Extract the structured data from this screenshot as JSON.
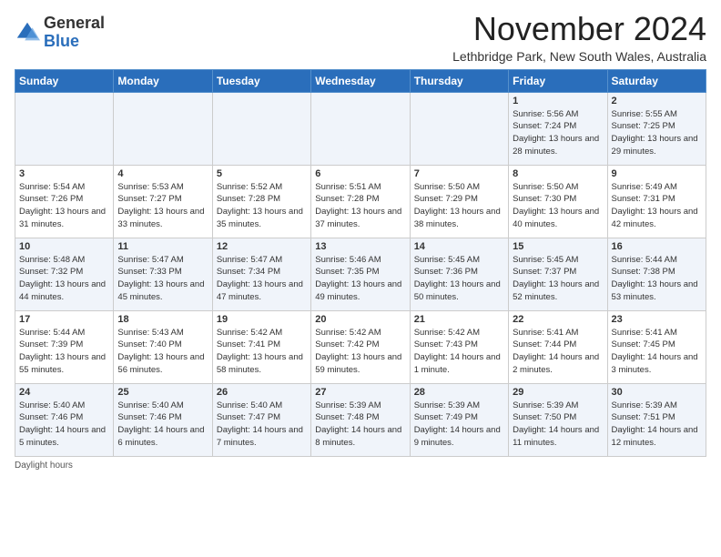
{
  "logo": {
    "text_general": "General",
    "text_blue": "Blue"
  },
  "header": {
    "title": "November 2024",
    "subtitle": "Lethbridge Park, New South Wales, Australia"
  },
  "days_of_week": [
    "Sunday",
    "Monday",
    "Tuesday",
    "Wednesday",
    "Thursday",
    "Friday",
    "Saturday"
  ],
  "weeks": [
    [
      {
        "day": "",
        "info": ""
      },
      {
        "day": "",
        "info": ""
      },
      {
        "day": "",
        "info": ""
      },
      {
        "day": "",
        "info": ""
      },
      {
        "day": "",
        "info": ""
      },
      {
        "day": "1",
        "info": "Sunrise: 5:56 AM\nSunset: 7:24 PM\nDaylight: 13 hours and 28 minutes."
      },
      {
        "day": "2",
        "info": "Sunrise: 5:55 AM\nSunset: 7:25 PM\nDaylight: 13 hours and 29 minutes."
      }
    ],
    [
      {
        "day": "3",
        "info": "Sunrise: 5:54 AM\nSunset: 7:26 PM\nDaylight: 13 hours and 31 minutes."
      },
      {
        "day": "4",
        "info": "Sunrise: 5:53 AM\nSunset: 7:27 PM\nDaylight: 13 hours and 33 minutes."
      },
      {
        "day": "5",
        "info": "Sunrise: 5:52 AM\nSunset: 7:28 PM\nDaylight: 13 hours and 35 minutes."
      },
      {
        "day": "6",
        "info": "Sunrise: 5:51 AM\nSunset: 7:28 PM\nDaylight: 13 hours and 37 minutes."
      },
      {
        "day": "7",
        "info": "Sunrise: 5:50 AM\nSunset: 7:29 PM\nDaylight: 13 hours and 38 minutes."
      },
      {
        "day": "8",
        "info": "Sunrise: 5:50 AM\nSunset: 7:30 PM\nDaylight: 13 hours and 40 minutes."
      },
      {
        "day": "9",
        "info": "Sunrise: 5:49 AM\nSunset: 7:31 PM\nDaylight: 13 hours and 42 minutes."
      }
    ],
    [
      {
        "day": "10",
        "info": "Sunrise: 5:48 AM\nSunset: 7:32 PM\nDaylight: 13 hours and 44 minutes."
      },
      {
        "day": "11",
        "info": "Sunrise: 5:47 AM\nSunset: 7:33 PM\nDaylight: 13 hours and 45 minutes."
      },
      {
        "day": "12",
        "info": "Sunrise: 5:47 AM\nSunset: 7:34 PM\nDaylight: 13 hours and 47 minutes."
      },
      {
        "day": "13",
        "info": "Sunrise: 5:46 AM\nSunset: 7:35 PM\nDaylight: 13 hours and 49 minutes."
      },
      {
        "day": "14",
        "info": "Sunrise: 5:45 AM\nSunset: 7:36 PM\nDaylight: 13 hours and 50 minutes."
      },
      {
        "day": "15",
        "info": "Sunrise: 5:45 AM\nSunset: 7:37 PM\nDaylight: 13 hours and 52 minutes."
      },
      {
        "day": "16",
        "info": "Sunrise: 5:44 AM\nSunset: 7:38 PM\nDaylight: 13 hours and 53 minutes."
      }
    ],
    [
      {
        "day": "17",
        "info": "Sunrise: 5:44 AM\nSunset: 7:39 PM\nDaylight: 13 hours and 55 minutes."
      },
      {
        "day": "18",
        "info": "Sunrise: 5:43 AM\nSunset: 7:40 PM\nDaylight: 13 hours and 56 minutes."
      },
      {
        "day": "19",
        "info": "Sunrise: 5:42 AM\nSunset: 7:41 PM\nDaylight: 13 hours and 58 minutes."
      },
      {
        "day": "20",
        "info": "Sunrise: 5:42 AM\nSunset: 7:42 PM\nDaylight: 13 hours and 59 minutes."
      },
      {
        "day": "21",
        "info": "Sunrise: 5:42 AM\nSunset: 7:43 PM\nDaylight: 14 hours and 1 minute."
      },
      {
        "day": "22",
        "info": "Sunrise: 5:41 AM\nSunset: 7:44 PM\nDaylight: 14 hours and 2 minutes."
      },
      {
        "day": "23",
        "info": "Sunrise: 5:41 AM\nSunset: 7:45 PM\nDaylight: 14 hours and 3 minutes."
      }
    ],
    [
      {
        "day": "24",
        "info": "Sunrise: 5:40 AM\nSunset: 7:46 PM\nDaylight: 14 hours and 5 minutes."
      },
      {
        "day": "25",
        "info": "Sunrise: 5:40 AM\nSunset: 7:46 PM\nDaylight: 14 hours and 6 minutes."
      },
      {
        "day": "26",
        "info": "Sunrise: 5:40 AM\nSunset: 7:47 PM\nDaylight: 14 hours and 7 minutes."
      },
      {
        "day": "27",
        "info": "Sunrise: 5:39 AM\nSunset: 7:48 PM\nDaylight: 14 hours and 8 minutes."
      },
      {
        "day": "28",
        "info": "Sunrise: 5:39 AM\nSunset: 7:49 PM\nDaylight: 14 hours and 9 minutes."
      },
      {
        "day": "29",
        "info": "Sunrise: 5:39 AM\nSunset: 7:50 PM\nDaylight: 14 hours and 11 minutes."
      },
      {
        "day": "30",
        "info": "Sunrise: 5:39 AM\nSunset: 7:51 PM\nDaylight: 14 hours and 12 minutes."
      }
    ]
  ],
  "footer": {
    "daylight_label": "Daylight hours"
  }
}
